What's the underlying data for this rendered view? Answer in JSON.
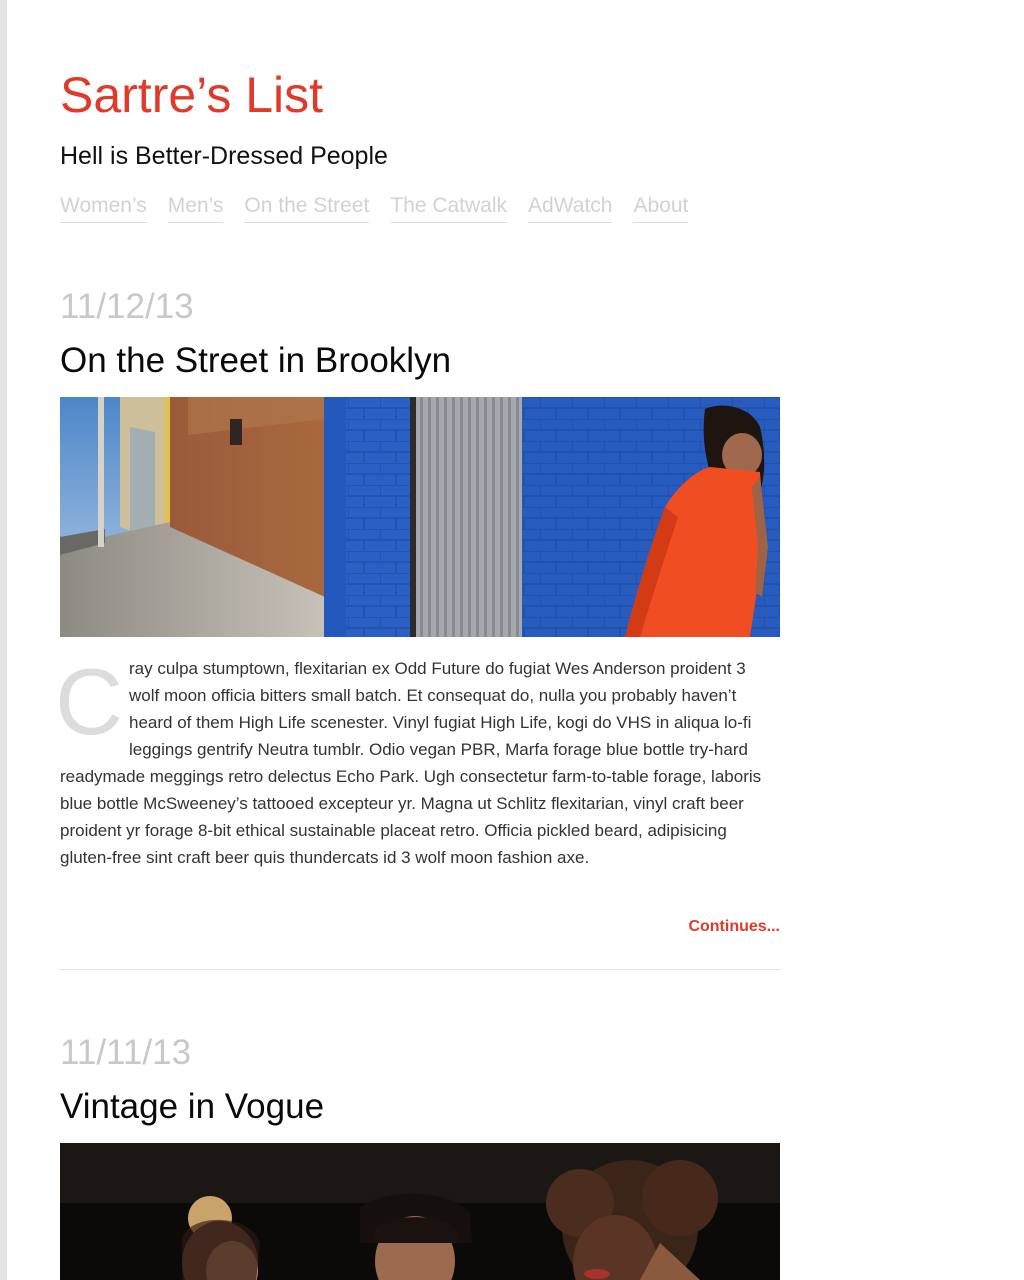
{
  "site": {
    "title": "Sartre’s List",
    "tagline": "Hell is Better-Dressed People"
  },
  "nav": {
    "items": [
      "Women’s",
      "Men’s",
      "On the Street",
      "The Catwalk",
      "AdWatch",
      "About"
    ]
  },
  "posts": [
    {
      "date": "11/12/13",
      "title": "On the Street in Brooklyn",
      "dropcap": "C",
      "body": "ray culpa stumptown, flexitarian ex Odd Future do fugiat Wes Anderson proident 3 wolf moon officia bitters small batch. Et consequat do, nulla you probably haven’t heard of them High Life scenester. Vinyl fugiat High Life, kogi do VHS in aliqua lo-fi leggings gentrify Neutra tumblr. Odio vegan PBR, Marfa forage blue bottle try-hard readymade meggings retro delectus Echo Park. Ugh consectetur farm-to-table forage, laboris blue bottle McSweeney’s tattooed excepteur yr. Magna ut Schlitz flexitarian, vinyl craft beer proident yr forage 8-bit ethical sustainable placeat retro. Officia pickled beard, adipisicing gluten-free sint craft beer quis thundercats id 3 wolf moon fashion axe.",
      "continues": "Continues..."
    },
    {
      "date": "11/11/13",
      "title": "Vintage in Vogue"
    }
  ],
  "colors": {
    "accent": "#e03a2b",
    "nav_text": "#d2d2d2",
    "date_text": "#c8c8c8"
  }
}
